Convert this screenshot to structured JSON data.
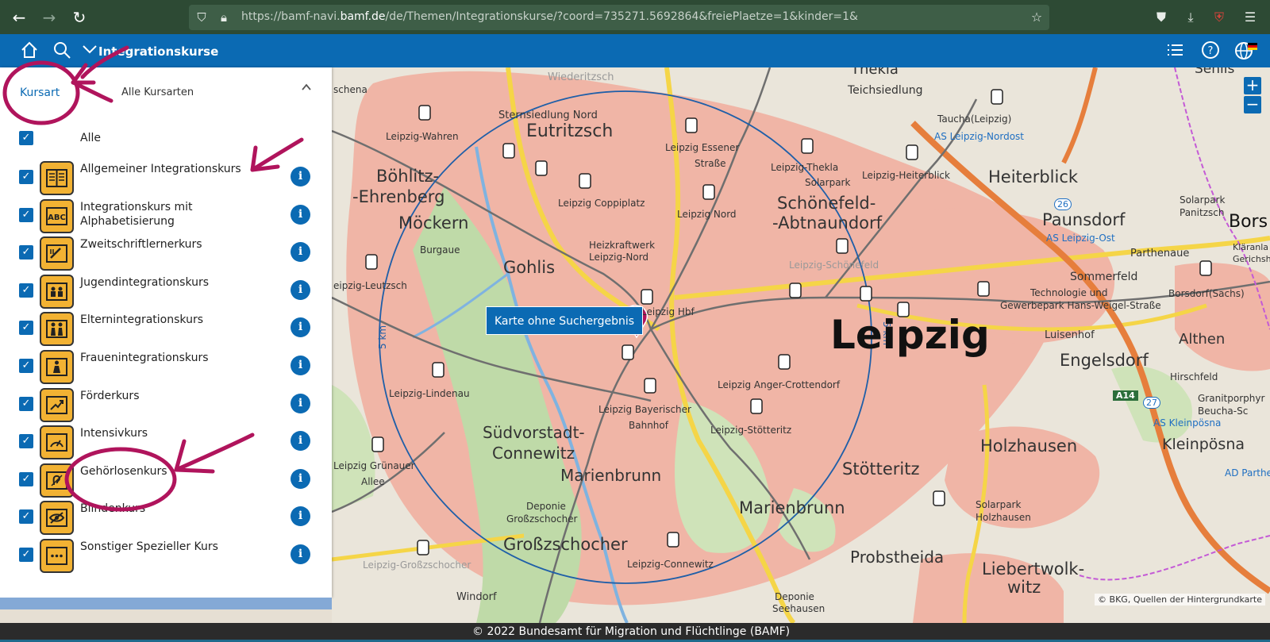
{
  "browser": {
    "url_prefix": "https://bamf-navi.",
    "url_domain": "bamf.de",
    "url_suffix": "/de/Themen/Integrationskurse/?coord=735271.5692864&freiePlaetze=1&kinder=1&"
  },
  "header": {
    "title": "Integrationskurse"
  },
  "sidebar": {
    "tab_label": "Kursart",
    "selected_value": "Alle Kursarten",
    "all_label": "Alle",
    "courses": [
      {
        "label": "Allgemeiner Integrationskurs",
        "icon": "book-icon"
      },
      {
        "label": "Integrationskurs mit Alphabetisierung",
        "icon": "abc-icon"
      },
      {
        "label": "Zweitschriftlernerkurs",
        "icon": "pen-book-icon"
      },
      {
        "label": "Jugendintegrationskurs",
        "icon": "youth-icon"
      },
      {
        "label": "Elternintegrationskurs",
        "icon": "parents-icon"
      },
      {
        "label": "Frauenintegrationskurs",
        "icon": "woman-icon"
      },
      {
        "label": "Förderkurs",
        "icon": "trend-up-icon"
      },
      {
        "label": "Intensivkurs",
        "icon": "speedometer-icon"
      },
      {
        "label": "Gehörlosenkurs",
        "icon": "deaf-icon"
      },
      {
        "label": "Blindenkurs",
        "icon": "blind-eye-icon"
      },
      {
        "label": "Sonstiger Spezieller Kurs",
        "icon": "speech-bubble-icon"
      }
    ],
    "info_glyph": "i"
  },
  "map": {
    "tooltip": "Karte ohne Suchergebnis",
    "radius_label": "5 km",
    "attribution": "© BKG, Quellen der Hintergrundkarte",
    "zoom_in": "+",
    "zoom_out": "−",
    "labels": [
      {
        "text": "Wiederitzsch"
      },
      {
        "text": "Thekla"
      },
      {
        "text": "Sehlis"
      },
      {
        "text": "Teichsiedlung"
      },
      {
        "text": "schena"
      },
      {
        "text": "Sternsiedlung Nord"
      },
      {
        "text": "Eutritzsch"
      },
      {
        "text": "Leipzig-Wahren"
      },
      {
        "text": "Taucha(Leipzig)"
      },
      {
        "text": "AS Leipzig-Nordost"
      },
      {
        "text": "Leipzig Essener"
      },
      {
        "text": "Straße"
      },
      {
        "text": "Leipzig-Thekla"
      },
      {
        "text": "Leipzig-Heiterblick"
      },
      {
        "text": "Heiterblick"
      },
      {
        "text": "Böhlitz-"
      },
      {
        "text": "-Ehrenberg"
      },
      {
        "text": "Solarpark"
      },
      {
        "text": "Schönefeld-"
      },
      {
        "text": "-Abtnaundorf"
      },
      {
        "text": "Leipzig Coppiplatz"
      },
      {
        "text": "Leipzig Nord"
      },
      {
        "text": "Möckern"
      },
      {
        "text": "Paunsdorf"
      },
      {
        "text": "Solarpark"
      },
      {
        "text": "Panitzsch"
      },
      {
        "text": "Bors"
      },
      {
        "text": "Burgaue"
      },
      {
        "text": "Heizkraftwerk"
      },
      {
        "text": "Leipzig-Nord"
      },
      {
        "text": "AS Leipzig-Ost"
      },
      {
        "text": "Kläranla"
      },
      {
        "text": "Gerichsh"
      },
      {
        "text": "Gohlis"
      },
      {
        "text": "Leipzig-Schönefeld"
      },
      {
        "text": "Parthenaue"
      },
      {
        "text": "Sommerfeld"
      },
      {
        "text": "eipzig-Leutzsch"
      },
      {
        "text": "Technologie und"
      },
      {
        "text": "Gewerbepark Hans-Weigel-Straße"
      },
      {
        "text": "Borsdorf(Sachs)"
      },
      {
        "text": "Leipzig Hbf"
      },
      {
        "text": "Leipzig"
      },
      {
        "text": "Luisenhof"
      },
      {
        "text": "Althen"
      },
      {
        "text": "Engelsdorf"
      },
      {
        "text": "Hirschfeld"
      },
      {
        "text": "Leipzig-Lindenau"
      },
      {
        "text": "Leipzig Anger-Crottendorf"
      },
      {
        "text": "Granitporphyr"
      },
      {
        "text": "Beucha-Sc"
      },
      {
        "text": "Leipzig Bayerischer"
      },
      {
        "text": "Bahnhof"
      },
      {
        "text": "Leipzig-Stötteritz"
      },
      {
        "text": "AS Kleinpösna"
      },
      {
        "text": "Südvorstadt-"
      },
      {
        "text": "Connewitz"
      },
      {
        "text": "Holzhausen"
      },
      {
        "text": "Kleinpösna"
      },
      {
        "text": "Leipzig Grünauer"
      },
      {
        "text": "Allee"
      },
      {
        "text": "Marienbrunn"
      },
      {
        "text": "Stötteritz"
      },
      {
        "text": "AD Parthe"
      },
      {
        "text": "Deponie"
      },
      {
        "text": "Großzschocher"
      },
      {
        "text": "Marienbrunn"
      },
      {
        "text": "Solarpark"
      },
      {
        "text": "Holzhausen"
      },
      {
        "text": "Großzschocher"
      },
      {
        "text": "Probstheida"
      },
      {
        "text": "Liebertwolk-"
      },
      {
        "text": "witz"
      },
      {
        "text": "Leipzig-Großzschocher"
      },
      {
        "text": "Leipzig-Connewitz"
      },
      {
        "text": "Windorf"
      },
      {
        "text": "Deponie"
      },
      {
        "text": "Seehausen"
      },
      {
        "text": "A14"
      },
      {
        "text": "26"
      },
      {
        "text": "27"
      }
    ]
  },
  "footer": {
    "copyright": "© 2022 Bundesamt für Migration und Flüchtlinge (BAMF)"
  },
  "colors": {
    "brand_blue": "#0b6ab3",
    "icon_yellow": "#f2b233",
    "annotation_magenta": "#b0145c",
    "browser_green": "#2d4a34"
  }
}
